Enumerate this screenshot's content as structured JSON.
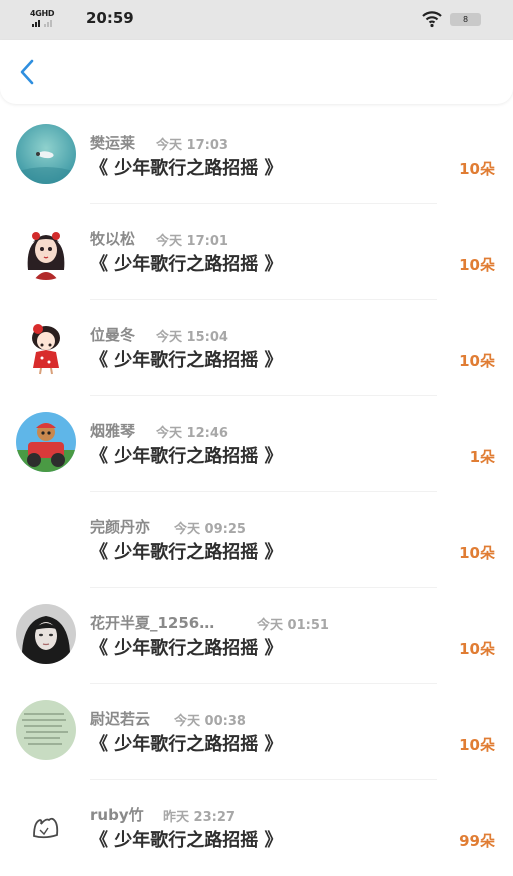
{
  "status_bar": {
    "network": "4GHD",
    "time": "20:59",
    "battery": "8"
  },
  "header": {
    "back_icon": "chevron-left-icon"
  },
  "colors": {
    "accent": "#2f8fdf",
    "count": "#e07d34",
    "name": "#8a8a8a"
  },
  "items": [
    {
      "name": "樊运莱",
      "time": "今天 17:03",
      "title": "《 少年歌行之路招摇 》",
      "count": "10朵"
    },
    {
      "name": "牧以松",
      "time": "今天 17:01",
      "title": "《 少年歌行之路招摇 》",
      "count": "10朵"
    },
    {
      "name": "位曼冬",
      "time": "今天 15:04",
      "title": "《 少年歌行之路招摇 》",
      "count": "10朵"
    },
    {
      "name": "烟雅琴",
      "time": "今天 12:46",
      "title": "《 少年歌行之路招摇 》",
      "count": "1朵"
    },
    {
      "name": "完颜丹亦",
      "time": "今天 09:25",
      "title": "《 少年歌行之路招摇 》",
      "count": "10朵"
    },
    {
      "name": "花开半夏_1256…",
      "time": "今天 01:51",
      "title": "《 少年歌行之路招摇 》",
      "count": "10朵"
    },
    {
      "name": "尉迟若云",
      "time": "今天 00:38",
      "title": "《 少年歌行之路招摇 》",
      "count": "10朵"
    },
    {
      "name": "ruby竹",
      "time": "昨天 23:27",
      "title": "《 少年歌行之路招摇 》",
      "count": "99朵"
    }
  ]
}
